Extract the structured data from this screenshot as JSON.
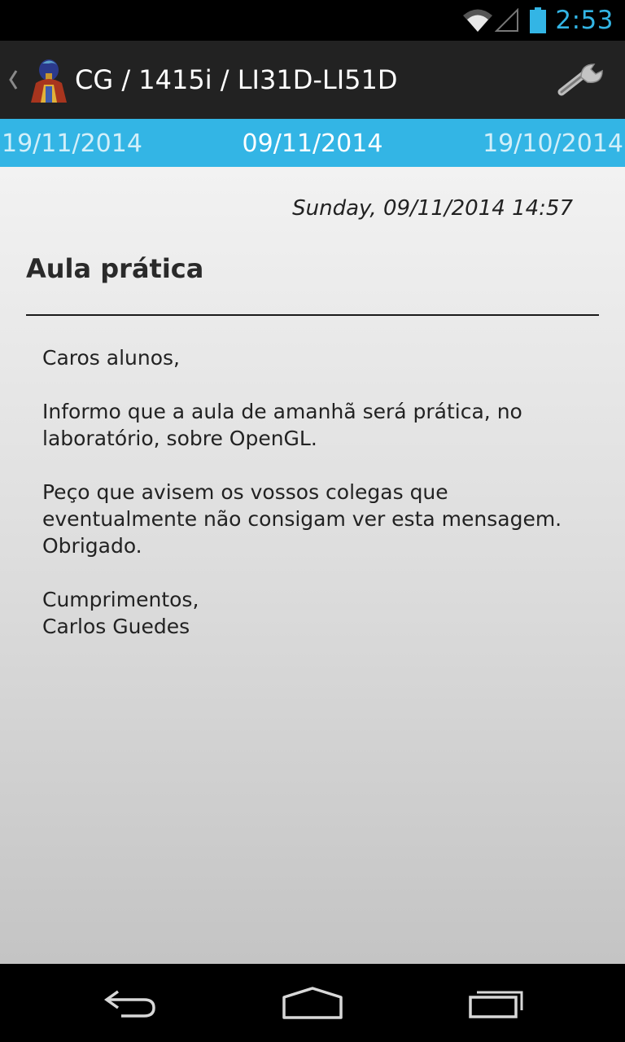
{
  "status_bar": {
    "time": "2:53",
    "icons": [
      "wifi-icon",
      "signal-icon",
      "battery-icon"
    ],
    "accent": "#33b5e5"
  },
  "action_bar": {
    "title": "CG / 1415i / LI31D-LI51D",
    "background": "#222222"
  },
  "date_tabs": {
    "prev": "19/11/2014",
    "current": "09/11/2014",
    "next": "19/10/2014",
    "background": "#33b5e5"
  },
  "post": {
    "timestamp": "Sunday, 09/11/2014 14:57",
    "title": "Aula prática",
    "paragraphs": [
      "Caros alunos,",
      "Informo que a aula de amanhã será prática, no laboratório, sobre OpenGL.",
      "Peço que avisem os vossos colegas que eventualmente não consigam ver esta mensagem. Obrigado.",
      "Cumprimentos,\nCarlos Guedes"
    ]
  }
}
